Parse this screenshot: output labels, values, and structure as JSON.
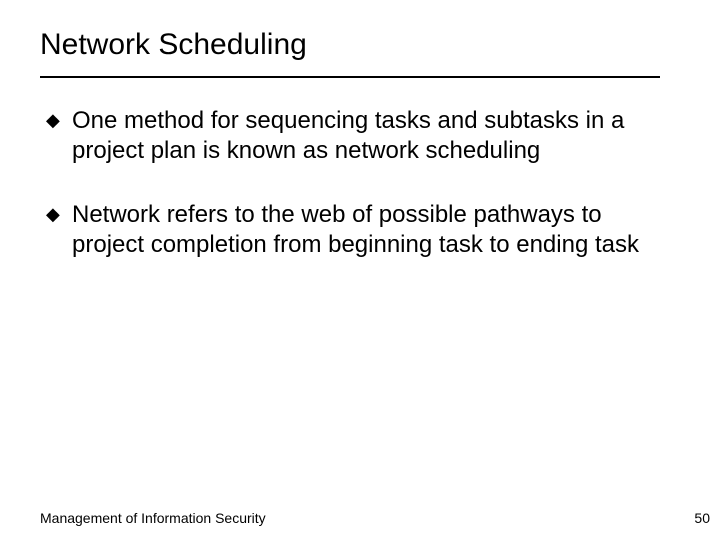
{
  "title": "Network Scheduling",
  "bullets": [
    "One method for sequencing tasks and subtasks in a project plan is known as network scheduling",
    "Network refers to the web of possible pathways to project completion from beginning task to ending task"
  ],
  "footer": "Management of Information Security",
  "page": "50"
}
